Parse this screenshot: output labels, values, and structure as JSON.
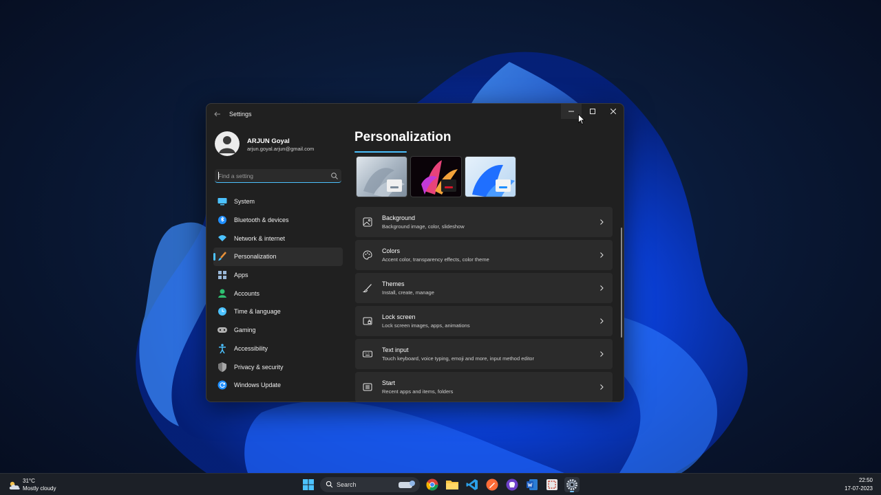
{
  "window": {
    "app_title": "Settings",
    "controls": {
      "minimize": "minimize",
      "maximize": "maximize",
      "close": "close"
    }
  },
  "profile": {
    "name": "ARJUN Goyal",
    "email": "arjun.goyal.arjun@gmail.com"
  },
  "search": {
    "placeholder": "Find a setting"
  },
  "nav": {
    "items": [
      {
        "label": "System",
        "icon": "monitor-icon",
        "color": "#4cc2ff"
      },
      {
        "label": "Bluetooth & devices",
        "icon": "bluetooth-icon",
        "color": "#1f8fff"
      },
      {
        "label": "Network & internet",
        "icon": "wifi-icon",
        "color": "#4cc2ff"
      },
      {
        "label": "Personalization",
        "icon": "brush-icon",
        "color": "#e8913a",
        "active": true
      },
      {
        "label": "Apps",
        "icon": "apps-icon",
        "color": "#9ab8d8"
      },
      {
        "label": "Accounts",
        "icon": "person-icon",
        "color": "#2fbf71"
      },
      {
        "label": "Time & language",
        "icon": "globe-clock-icon",
        "color": "#4cc2ff"
      },
      {
        "label": "Gaming",
        "icon": "gamepad-icon",
        "color": "#b0b0b0"
      },
      {
        "label": "Accessibility",
        "icon": "accessibility-icon",
        "color": "#4cc2ff"
      },
      {
        "label": "Privacy & security",
        "icon": "shield-icon",
        "color": "#a8a8a8"
      },
      {
        "label": "Windows Update",
        "icon": "update-icon",
        "color": "#1f8fff"
      }
    ]
  },
  "content": {
    "title": "Personalization",
    "themes": [
      {
        "name": "theme-flow",
        "bg": "#b7c3cf",
        "accent": "#7a8a99"
      },
      {
        "name": "theme-glow",
        "bg": "#2a0c1a",
        "accent": "#d0162a"
      },
      {
        "name": "theme-bloom",
        "bg": "#cfe4f8",
        "accent": "#1f8fff"
      }
    ],
    "cards": [
      {
        "title": "Background",
        "subtitle": "Background image, color, slideshow",
        "icon": "image-icon"
      },
      {
        "title": "Colors",
        "subtitle": "Accent color, transparency effects, color theme",
        "icon": "palette-icon"
      },
      {
        "title": "Themes",
        "subtitle": "Install, create, manage",
        "icon": "brush-icon"
      },
      {
        "title": "Lock screen",
        "subtitle": "Lock screen images, apps, animations",
        "icon": "lock-screen-icon"
      },
      {
        "title": "Text input",
        "subtitle": "Touch keyboard, voice typing, emoji and more, input method editor",
        "icon": "keyboard-icon"
      },
      {
        "title": "Start",
        "subtitle": "Recent apps and items, folders",
        "icon": "start-icon"
      }
    ]
  },
  "taskbar": {
    "weather": {
      "temp": "31°C",
      "desc": "Mostly cloudy"
    },
    "search_label": "Search",
    "clock": {
      "time": "22:50",
      "date": "17-07-2023"
    },
    "apps": [
      "start-icon",
      "chrome-icon",
      "file-explorer-icon",
      "vscode-icon",
      "postman-icon",
      "github-icon",
      "word-icon",
      "snipping-icon",
      "settings-icon"
    ]
  }
}
